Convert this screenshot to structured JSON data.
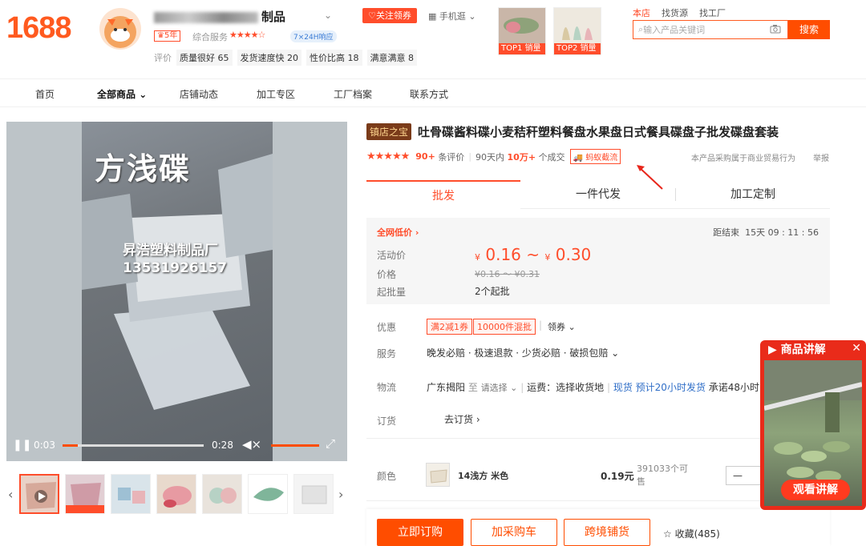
{
  "header": {
    "logo": "1688",
    "shop_name_visible": "制品",
    "follow_btn": "关注领券",
    "mobile_link": "手机逛",
    "year_badge": "5年",
    "service_label": "综合服务",
    "service_stars": "★★★★☆",
    "response_badge": "7×24H响应",
    "eval_label": "评价",
    "eval_tags": [
      "质量很好 65",
      "发货速度快 20",
      "性价比高 18",
      "满意满意 8"
    ],
    "top_products": [
      {
        "rank": "TOP1",
        "label": "销量"
      },
      {
        "rank": "TOP2",
        "label": "销量"
      }
    ]
  },
  "search": {
    "tabs": [
      "本店",
      "找货源",
      "找工厂"
    ],
    "placeholder": "输入产品关键词",
    "button": "搜索"
  },
  "nav": {
    "items": [
      "首页",
      "全部商品",
      "店铺动态",
      "加工专区",
      "工厂档案",
      "联系方式"
    ]
  },
  "video": {
    "overlay_title": "方浅碟",
    "overlay_line1": "昇浩塑料制品厂",
    "overlay_line2": "13531926157",
    "current_time": "0:03",
    "duration": "0:28",
    "progress": 0.11
  },
  "product": {
    "shop_tag": "镇店之宝",
    "title": "吐骨碟酱料碟小麦秸秆塑料餐盘水果盘日式餐具碟盘子批发碟盘套装",
    "stars": "★★★★★",
    "review_count": "90+",
    "review_label": "条评价",
    "sales_prefix": "90天内",
    "sales_count": "10万+",
    "sales_label": "个成交",
    "ship_badge": "蚂蚁截流",
    "biz_note": "本产品采购属于商业贸易行为",
    "report": "举报"
  },
  "tabs": [
    "批发",
    "一件代发",
    "加工定制"
  ],
  "price": {
    "lowest_label": "全网低价",
    "countdown_label": "距结束",
    "countdown": "15天 09 : 11 : 56",
    "activity_label": "活动价",
    "currency": "¥",
    "activity_low": "0.16",
    "activity_high": "0.30",
    "price_label": "价格",
    "original": "¥0.16 ～ ¥0.31",
    "moq_label": "起批量",
    "moq": "2个起批"
  },
  "info": {
    "promo_label": "优惠",
    "promo_tags": [
      "满2减1券",
      "10000件混批"
    ],
    "coupon_link": "领券",
    "service_label": "服务",
    "service_value": "晚发必赔 · 极速退款 · 少货必赔 · 破损包赔",
    "logistics_label": "物流",
    "origin": "广东揭阳",
    "to": "至",
    "choose": "请选择",
    "freight": "运费：选择收货地",
    "stock": "现货",
    "ship_time": "预计20小时发货",
    "promise": "承诺48小时",
    "order_label": "订货",
    "order_link": "去订货"
  },
  "sku": {
    "color_label": "颜色",
    "name": "14浅方 米色",
    "price": "0.19元",
    "stock_line1": "391033个可",
    "stock_line2": "售",
    "qty": "—"
  },
  "actions": {
    "buy": "立即订购",
    "cart": "加采购车",
    "cross": "跨境铺货",
    "favorite": "收藏(485)"
  },
  "live": {
    "title": "商品讲解",
    "watch": "观看讲解"
  }
}
